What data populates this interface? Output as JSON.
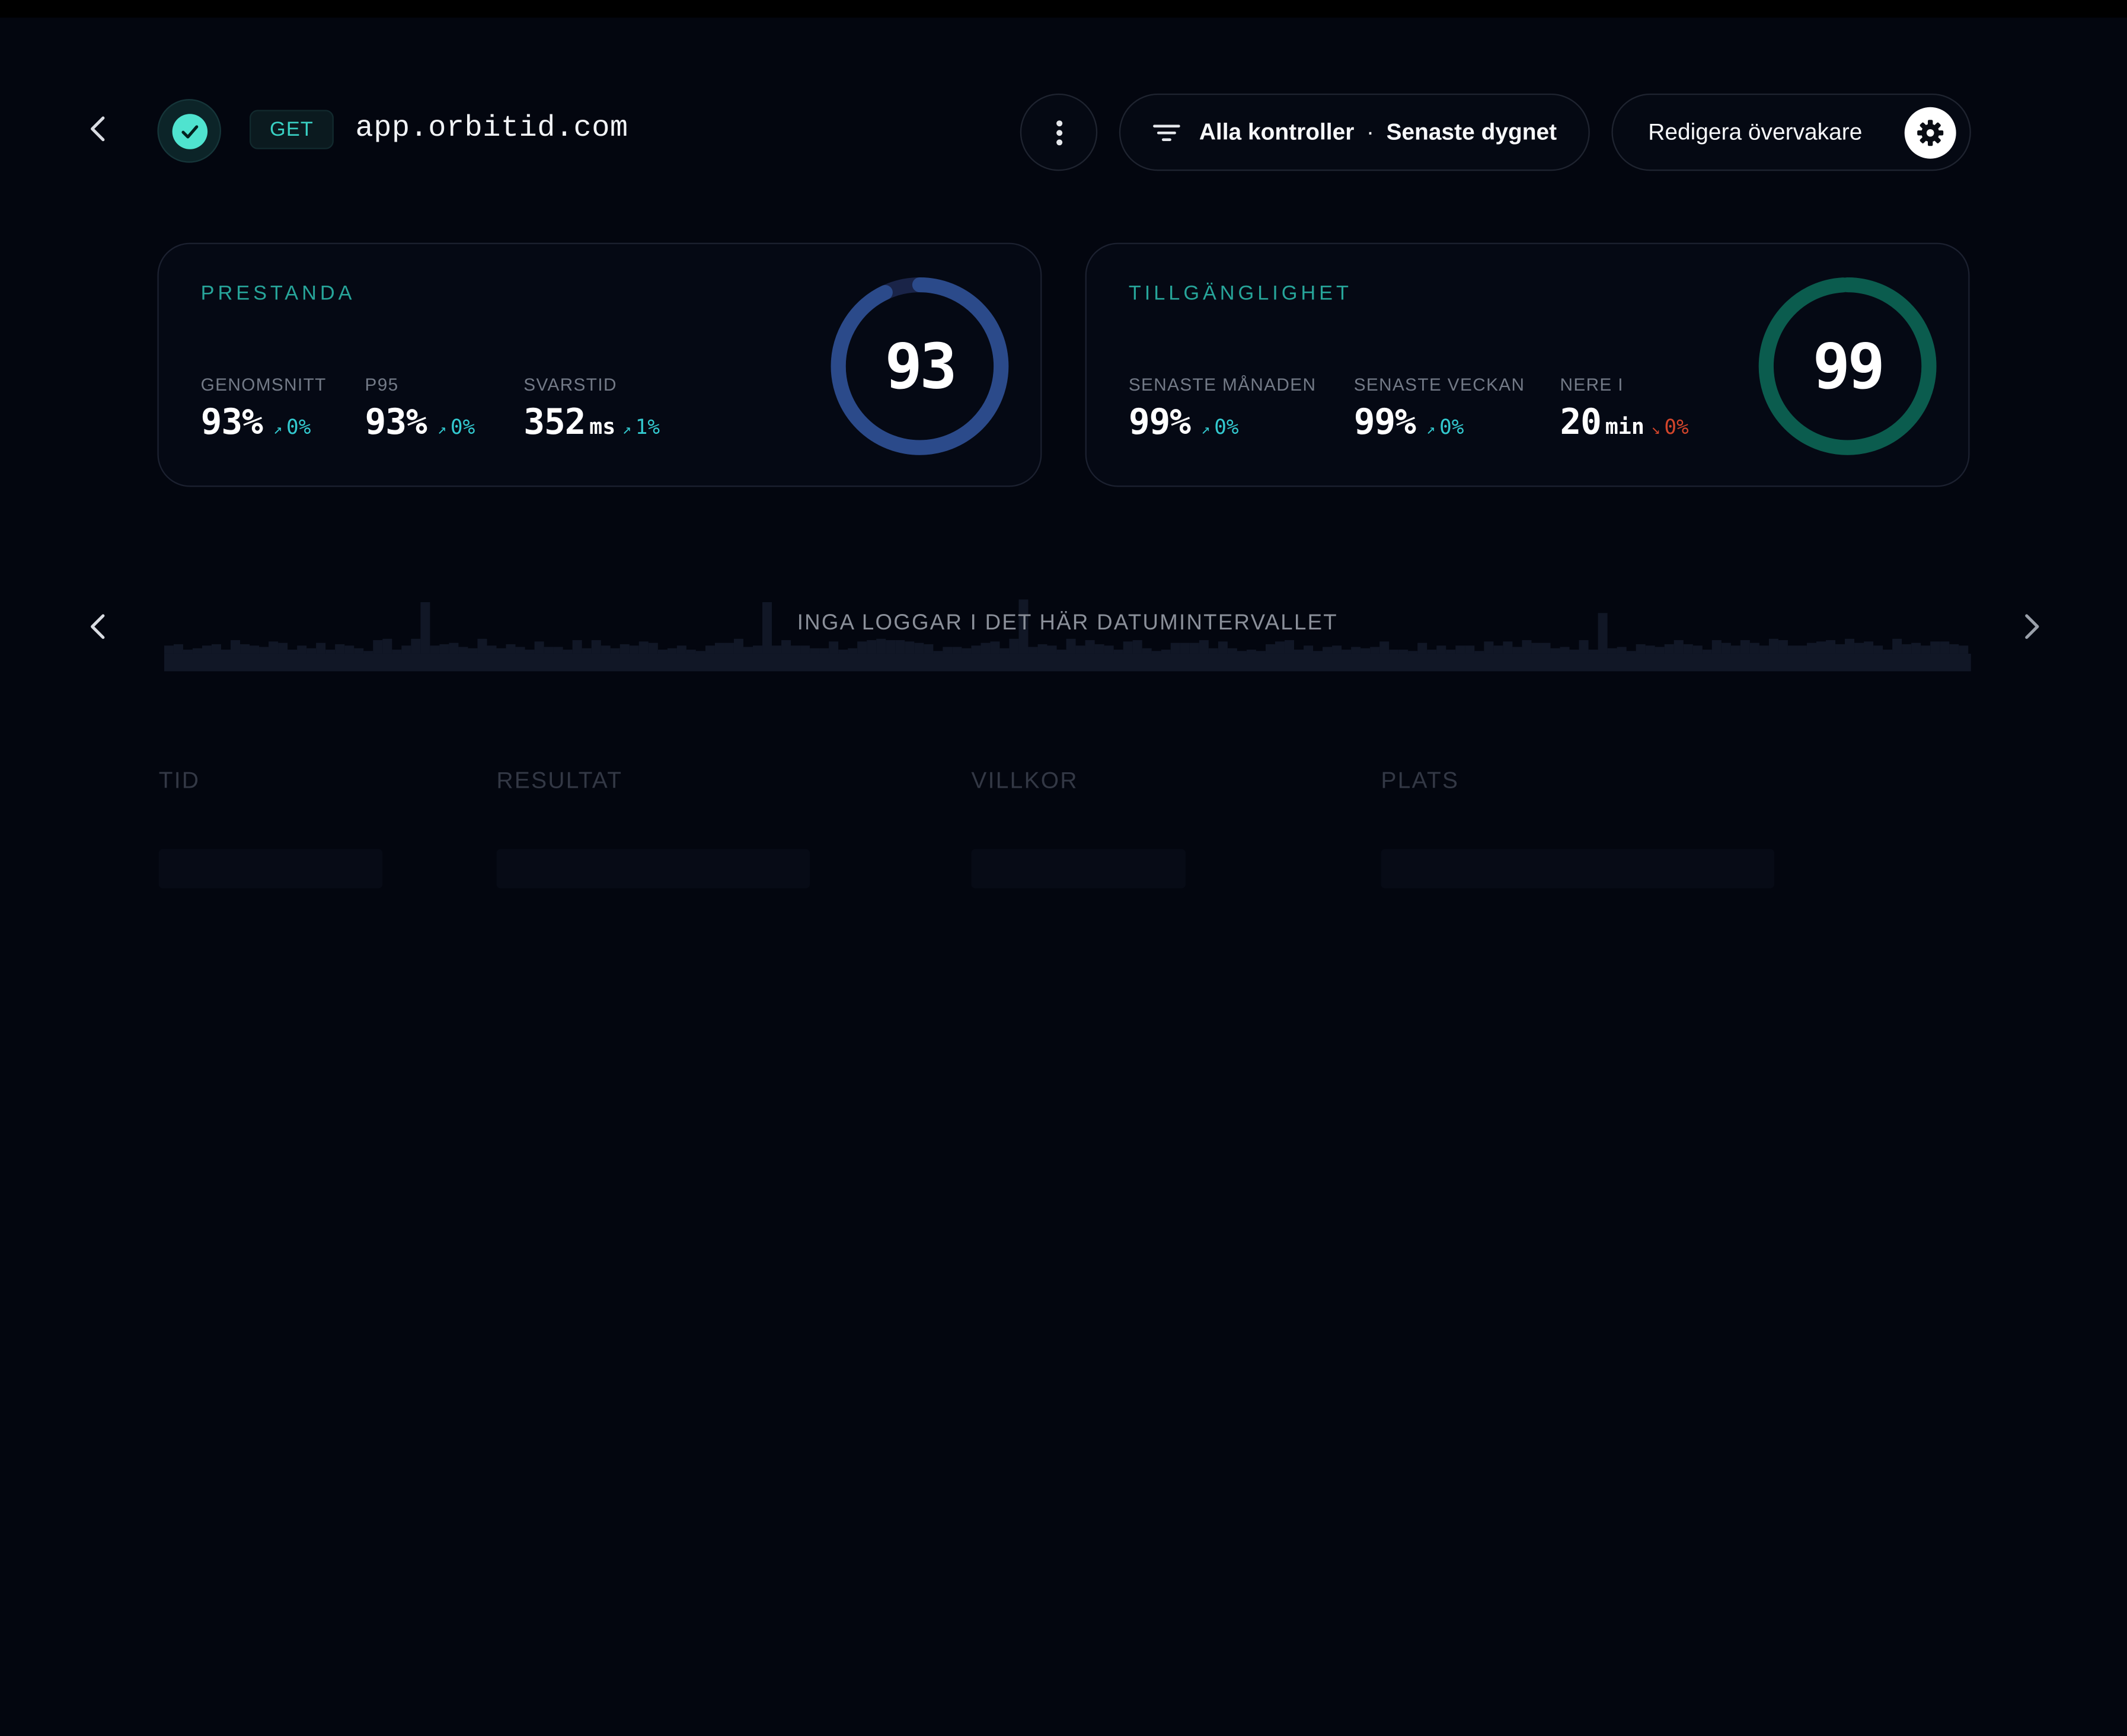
{
  "header": {
    "back_icon": "chevron-left-icon",
    "status": "up",
    "method": "GET",
    "url": "app.orbitid.com",
    "more_icon": "vertical-dots-icon",
    "filter": {
      "icon": "filter-lines-icon",
      "checks": "Alla kontroller",
      "separator": "·",
      "range": "Senaste dygnet"
    },
    "edit": {
      "label": "Redigera övervakare",
      "icon": "gear-icon"
    }
  },
  "performance": {
    "title": "PRESTANDA",
    "score": "93",
    "score_fraction": 0.93,
    "metrics": [
      {
        "label": "GENOMSNITT",
        "value": "93%",
        "unit": "",
        "trend": "0%",
        "direction": "up"
      },
      {
        "label": "P95",
        "value": "93%",
        "unit": "",
        "trend": "0%",
        "direction": "up"
      },
      {
        "label": "SVARSTID",
        "value": "352",
        "unit": "ms",
        "trend": "1%",
        "direction": "up"
      }
    ]
  },
  "availability": {
    "title": "TILLGÄNGLIGHET",
    "score": "99",
    "score_fraction": 0.99,
    "metrics": [
      {
        "label": "SENASTE MÅNADEN",
        "value": "99%",
        "unit": "",
        "trend": "0%",
        "direction": "up"
      },
      {
        "label": "SENASTE VECKAN",
        "value": "99%",
        "unit": "",
        "trend": "0%",
        "direction": "up"
      },
      {
        "label": "NERE I",
        "value": "20",
        "unit": "min",
        "trend": "0%",
        "direction": "down"
      }
    ]
  },
  "timeline": {
    "empty_message": "INGA LOGGAR I DET HÄR DATUMINTERVALLET",
    "prev_icon": "chevron-left-icon",
    "next_icon": "chevron-right-icon"
  },
  "table": {
    "columns": [
      "TID",
      "RESULTAT",
      "VILLKOR",
      "PLATS"
    ]
  },
  "colors": {
    "background": "#03060f",
    "accent_teal": "#33c9cf",
    "trend_down": "#d2452b",
    "perf_ring": "#2b4a8a",
    "avail_ring": "#0b5c4e",
    "status_ok": "#4fe3cf"
  }
}
